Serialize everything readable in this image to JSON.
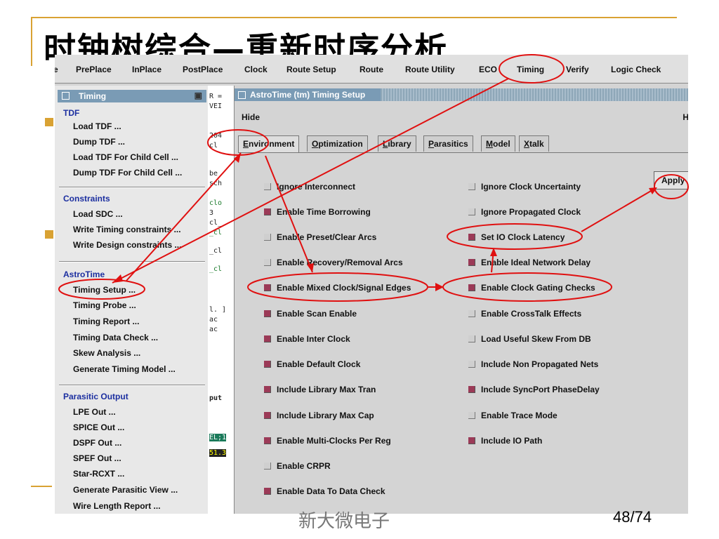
{
  "slide": {
    "title": "时钟树综合—重新时序分析",
    "footer": "新大微电子",
    "page": "48/74"
  },
  "menubar": {
    "items": [
      "e",
      "PrePlace",
      "InPlace",
      "PostPlace",
      "Clock",
      "Route Setup",
      "Route",
      "Route Utility",
      "ECO",
      "Timing",
      "Verify",
      "Logic Check"
    ]
  },
  "timing_panel": {
    "title": "Timing",
    "sections": [
      {
        "heading": "TDF",
        "items": [
          "Load TDF ...",
          "Dump TDF ...",
          "Load TDF For Child Cell ...",
          "Dump TDF For Child Cell ..."
        ]
      },
      {
        "heading": "Constraints",
        "items": [
          "Load SDC ...",
          "Write Timing constraints ...",
          "Write Design constraints ..."
        ]
      },
      {
        "heading": "AstroTime",
        "items": [
          "Timing Setup ...",
          "Timing Probe ...",
          "Timing Report ...",
          "Timing Data Check ...",
          "Skew Analysis ...",
          "Generate Timing Model ..."
        ]
      },
      {
        "heading": "Parasitic Output",
        "items": [
          "LPE Out ...",
          "SPICE Out ...",
          "DSPF Out ...",
          "SPEF Out ...",
          "Star-RCXT ...",
          "Generate Parasitic View ...",
          "Wire Length Report ..."
        ]
      }
    ]
  },
  "background_fragments": [
    "R =",
    "VEI",
    "204",
    "cl",
    "be",
    "sch",
    "clo",
    "3",
    "cl_",
    "_cl",
    "_cl",
    "_cl",
    "l. ]",
    "ac",
    "ac",
    "put",
    "EL;1",
    "51.3"
  ],
  "dialog": {
    "title": "AstroTime (tm) Timing Setup",
    "hide_label": "Hide",
    "right_label": "H",
    "apply_label": "Apply",
    "tabs": [
      {
        "underline": "E",
        "rest": "nvironment"
      },
      {
        "underline": "O",
        "rest": "ptimization"
      },
      {
        "underline": "L",
        "rest": "ibrary"
      },
      {
        "underline": "P",
        "rest": "arasitics"
      },
      {
        "underline": "M",
        "rest": "odel"
      },
      {
        "underline": "X",
        "rest": "talk"
      }
    ],
    "left_options": [
      {
        "label": "Ignore Interconnect",
        "checked": false
      },
      {
        "label": "Enable Time Borrowing",
        "checked": true
      },
      {
        "label": "Enable Preset/Clear Arcs",
        "checked": false
      },
      {
        "label": "Enable Recovery/Removal Arcs",
        "checked": false
      },
      {
        "label": "Enable Mixed Clock/Signal Edges",
        "checked": true
      },
      {
        "label": "Enable Scan Enable",
        "checked": true
      },
      {
        "label": "Enable Inter Clock",
        "checked": true
      },
      {
        "label": "Enable Default Clock",
        "checked": true
      },
      {
        "label": "Include Library Max Tran",
        "checked": true
      },
      {
        "label": "Include Library Max Cap",
        "checked": true
      },
      {
        "label": "Enable Multi-Clocks Per Reg",
        "checked": true
      },
      {
        "label": "Enable CRPR",
        "checked": false
      },
      {
        "label": "Enable Data To Data Check",
        "checked": true
      }
    ],
    "right_options": [
      {
        "label": "Ignore Clock Uncertainty",
        "checked": false
      },
      {
        "label": "Ignore Propagated Clock",
        "checked": false
      },
      {
        "label": "Set IO Clock Latency",
        "checked": true
      },
      {
        "label": "Enable Ideal Network Delay",
        "checked": true
      },
      {
        "label": "Enable Clock Gating Checks",
        "checked": true
      },
      {
        "label": "Enable CrossTalk Effects",
        "checked": false
      },
      {
        "label": "Load Useful Skew From DB",
        "checked": false
      },
      {
        "label": "Include Non Propagated Nets",
        "checked": false
      },
      {
        "label": "Include SyncPort PhaseDelay",
        "checked": true
      },
      {
        "label": "Enable Trace Mode",
        "checked": false
      },
      {
        "label": "Include IO Path",
        "checked": true
      }
    ]
  },
  "colors": {
    "accent_gold": "#d9a233",
    "annotation_red": "#e01010",
    "checked_box": "#9b3a57",
    "section_heading": "#1c2fa0",
    "title_bar": "#7a9bb5"
  }
}
